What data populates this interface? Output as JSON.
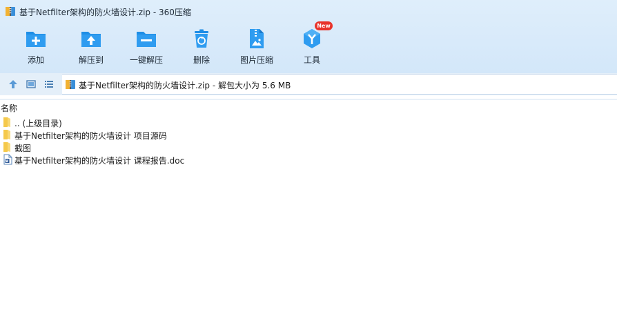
{
  "window": {
    "title": "基于Netfilter架构的防火墙设计.zip - 360压缩"
  },
  "toolbar": {
    "items": [
      {
        "label": "添加",
        "icon": "add-folder-icon"
      },
      {
        "label": "解压到",
        "icon": "extract-to-folder-icon"
      },
      {
        "label": "一键解压",
        "icon": "one-click-extract-icon"
      },
      {
        "label": "删除",
        "icon": "trash-recycle-icon"
      },
      {
        "label": "图片压缩",
        "icon": "image-compress-icon"
      },
      {
        "label": "工具",
        "icon": "tools-cube-icon",
        "badge": "New"
      }
    ]
  },
  "address": {
    "path_text": "基于Netfilter架构的防火墙设计.zip - 解包大小为 5.6 MB"
  },
  "list": {
    "column_name": "名称",
    "items": [
      {
        "name": ".. (上级目录)",
        "icon": "folder-icon"
      },
      {
        "name": "基于Netfilter架构的防火墙设计 项目源码",
        "icon": "folder-icon"
      },
      {
        "name": "截图",
        "icon": "folder-icon"
      },
      {
        "name": "基于Netfilter架构的防火墙设计 课程报告.doc",
        "icon": "word-document-icon"
      }
    ]
  },
  "colors": {
    "accent": "#1e8ee6",
    "header_bg": "#dcecfa",
    "badge": "#e8332a",
    "folder": "#f5c94b"
  }
}
